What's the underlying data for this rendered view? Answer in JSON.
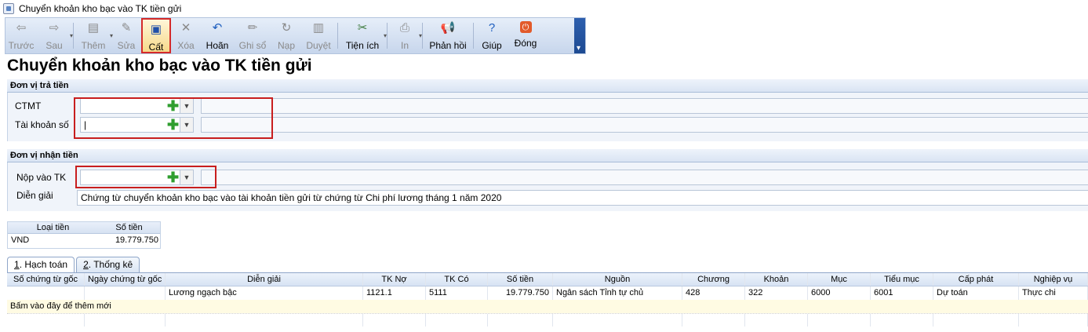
{
  "window": {
    "title": "Chuyển khoản kho bạc vào TK tiền gửi"
  },
  "toolbar": {
    "buttons": [
      {
        "label": "Trước",
        "icon": "arrow-left-icon",
        "enabled": false
      },
      {
        "label": "Sau",
        "icon": "arrow-right-icon",
        "enabled": false
      },
      {
        "label": "Thêm",
        "icon": "add-document-icon",
        "enabled": false
      },
      {
        "label": "Sửa",
        "icon": "edit-document-icon",
        "enabled": false
      },
      {
        "label": "Cất",
        "icon": "save-icon",
        "enabled": true
      },
      {
        "label": "Xóa",
        "icon": "delete-icon",
        "enabled": false
      },
      {
        "label": "Hoãn",
        "icon": "undo-icon",
        "enabled": true
      },
      {
        "label": "Ghi sổ",
        "icon": "pencil-icon",
        "enabled": false
      },
      {
        "label": "Nạp",
        "icon": "reload-icon",
        "enabled": false
      },
      {
        "label": "Duyệt",
        "icon": "approve-icon",
        "enabled": false
      },
      {
        "label": "Tiện ích",
        "icon": "tools-icon",
        "enabled": true
      },
      {
        "label": "In",
        "icon": "printer-icon",
        "enabled": false
      },
      {
        "label": "Phản hồi",
        "icon": "megaphone-icon",
        "enabled": true
      },
      {
        "label": "Giúp",
        "icon": "help-icon",
        "enabled": true
      },
      {
        "label": "Đóng",
        "icon": "close-icon",
        "enabled": true
      }
    ]
  },
  "page": {
    "title": "Chuyển khoản kho bạc vào TK tiền gửi"
  },
  "payer": {
    "header": "Đơn vị trả tiền",
    "ctmt_label": "CTMT",
    "ctmt_value": "",
    "account_label": "Tài khoản số",
    "account_value": "|"
  },
  "receiver": {
    "header": "Đơn vị nhận tiền",
    "deposit_label": "Nộp vào TK",
    "deposit_value": "",
    "description_label": "Diễn giải",
    "description_value": "Chứng từ chuyển khoản kho bạc vào tài khoản tiền gửi từ chứng từ Chi phí lương tháng 1 năm 2020"
  },
  "currency_table": {
    "headers": [
      "Loại tiền",
      "Số tiền"
    ],
    "rows": [
      [
        "VND",
        "19.779.750"
      ]
    ]
  },
  "tabs": [
    {
      "key": "1",
      "label": ". Hạch toán",
      "active": true
    },
    {
      "key": "2",
      "label": ". Thống kê",
      "active": false
    }
  ],
  "grid": {
    "columns": [
      "Số chứng từ gốc",
      "Ngày chứng từ gốc",
      "Diễn giải",
      "TK Nợ",
      "TK Có",
      "Số tiền",
      "Nguồn",
      "Chương",
      "Khoản",
      "Mục",
      "Tiểu mục",
      "Cấp phát",
      "Nghiệp vụ"
    ],
    "rows": [
      [
        "",
        "",
        "Lương ngạch bậc",
        "1121.1",
        "5111",
        "19.779.750",
        "Ngân sách Tỉnh tự chủ",
        "428",
        "322",
        "6000",
        "6001",
        "Dự toán",
        "Thực chi"
      ]
    ],
    "new_row_text": "Bấm vào đây để thêm mới"
  },
  "colors": {
    "highlight": "#c81e1e",
    "toolbar": "#c7d6ec",
    "new_row": "#fffbe3"
  }
}
